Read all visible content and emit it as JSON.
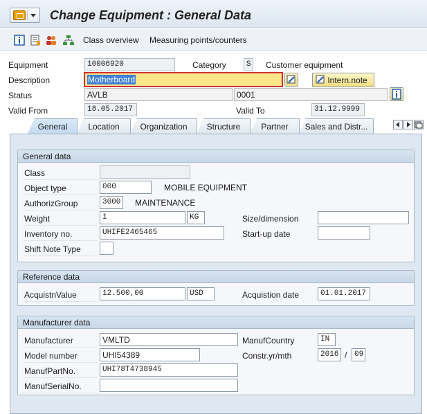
{
  "window": {
    "title": "Change Equipment : General Data"
  },
  "toolbar": {
    "class_overview": "Class overview",
    "measuring_points": "Measuring points/counters"
  },
  "header": {
    "equipment_label": "Equipment",
    "equipment_value": "10006920",
    "category_label": "Category",
    "category_value": "S",
    "category_text": "Customer equipment",
    "description_label": "Description",
    "description_value": "Motherboard",
    "intern_note_label": "Intern.note",
    "status_label": "Status",
    "status_value": "AVLB",
    "status_value2": "0001",
    "valid_from_label": "Valid From",
    "valid_from_value": "18.05.2017",
    "valid_to_label": "Valid To",
    "valid_to_value": "31.12.9999"
  },
  "tabs": [
    {
      "label": "General",
      "active": true
    },
    {
      "label": "Location"
    },
    {
      "label": "Organization"
    },
    {
      "label": "Structure"
    },
    {
      "label": "Partner"
    },
    {
      "label": "Sales and Distr..."
    }
  ],
  "general_data": {
    "title": "General data",
    "class_label": "Class",
    "class_value": "",
    "object_type_label": "Object type",
    "object_type_value": "000",
    "object_type_text": "MOBILE EQUIPMENT",
    "authoriz_group_label": "AuthorizGroup",
    "authoriz_group_value": "3000",
    "authoriz_group_text": "MAINTENANCE",
    "weight_label": "Weight",
    "weight_value": "1",
    "weight_unit": "KG",
    "size_label": "Size/dimension",
    "size_value": "",
    "inventory_label": "Inventory no.",
    "inventory_value": "UHIFE2465465",
    "startup_label": "Start-up date",
    "startup_value": "",
    "shift_note_label": "Shift Note Type",
    "shift_note_value": ""
  },
  "reference_data": {
    "title": "Reference data",
    "acq_value_label": "AcquistnValue",
    "acq_value": "12.500,00",
    "acq_currency": "USD",
    "acq_date_label": "Acquistion date",
    "acq_date_value": "01.01.2017"
  },
  "manufacturer_data": {
    "title": "Manufacturer data",
    "manufacturer_label": "Manufacturer",
    "manufacturer_value": "VMLTD",
    "country_label": "ManufCountry",
    "country_value": "IN",
    "model_label": "Model number",
    "model_value": "UHI54389",
    "constr_label": "Constr.yr/mth",
    "constr_year": "2016",
    "constr_sep": "/",
    "constr_month": "09",
    "partno_label": "ManufPartNo.",
    "partno_value": "UHI78T4738945",
    "serial_label": "ManufSerialNo.",
    "serial_value": ""
  },
  "colors": {
    "title_bg": "#dde6f0",
    "panel_bg": "#dfe8f1",
    "button_bg": "#f1df86",
    "description_bg": "#fde58a",
    "focus_border": "#d32f2f"
  }
}
